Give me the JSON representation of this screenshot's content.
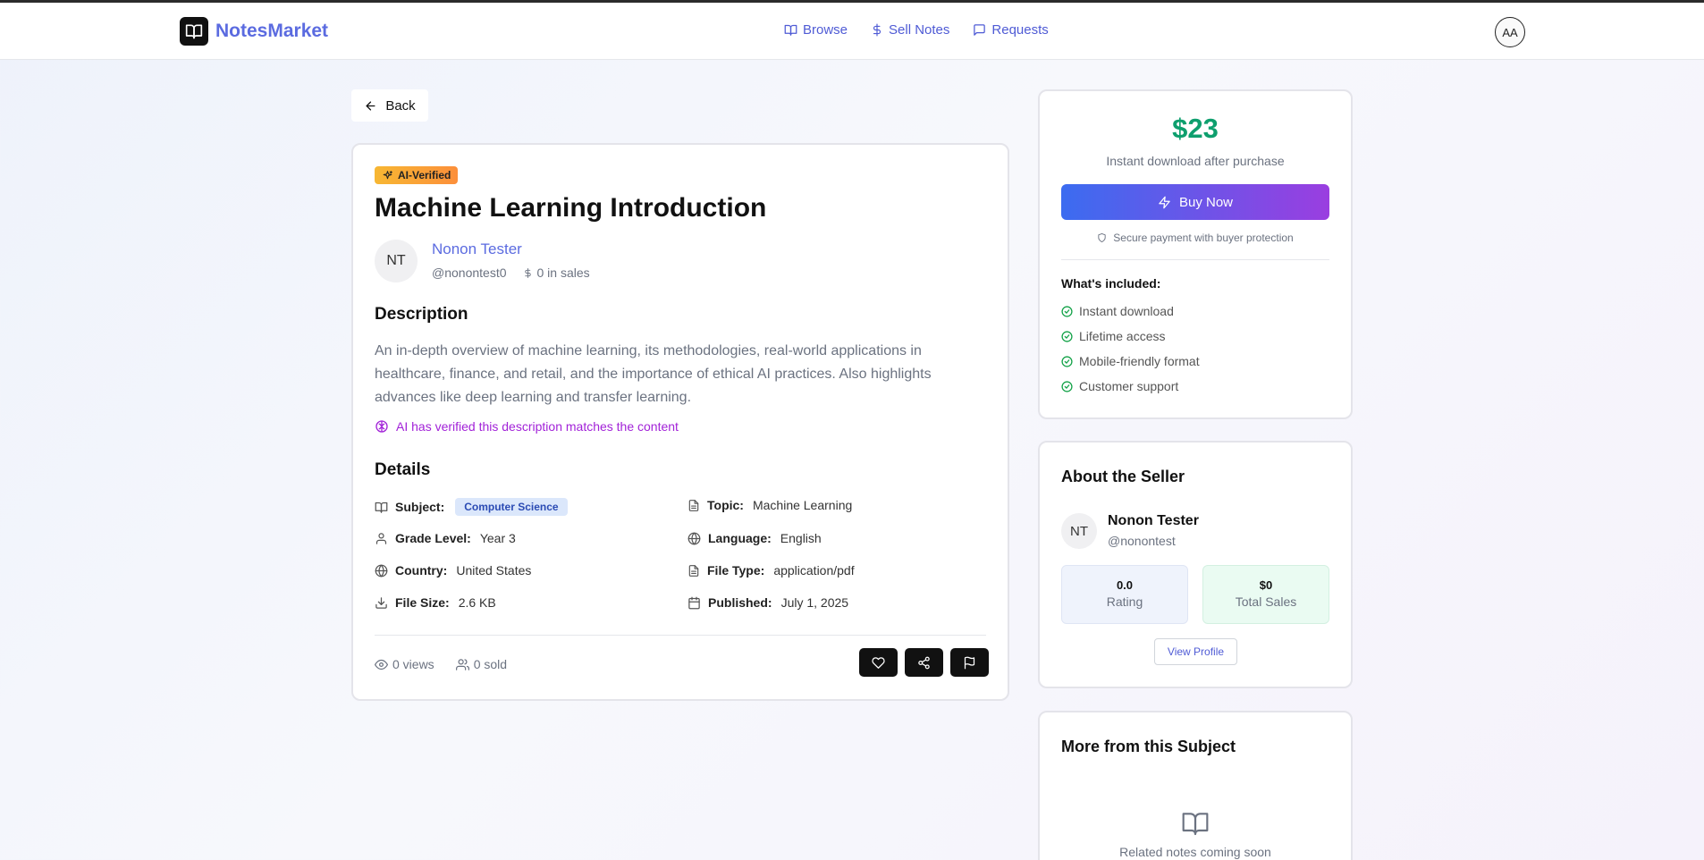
{
  "header": {
    "brand": "NotesMarket",
    "nav": [
      {
        "label": "Browse",
        "icon": "book-open-icon"
      },
      {
        "label": "Sell Notes",
        "icon": "dollar-icon"
      },
      {
        "label": "Requests",
        "icon": "message-icon"
      }
    ],
    "user_initials": "AA"
  },
  "back_label": "Back",
  "note": {
    "badge": "AI-Verified",
    "title": "Machine Learning Introduction",
    "author": {
      "initials": "NT",
      "name": "Nonon Tester",
      "handle": "@nonontest0",
      "sales": "0 in sales"
    },
    "description_heading": "Description",
    "description": "An in-depth overview of machine learning, its methodologies, real-world applications in healthcare, finance, and retail, and the importance of ethical AI practices. Also highlights advances like deep learning and transfer learning.",
    "ai_note": "AI has verified this description matches the content",
    "details_heading": "Details",
    "details": {
      "subject": {
        "label": "Subject:",
        "value": "Computer Science"
      },
      "topic": {
        "label": "Topic:",
        "value": "Machine Learning"
      },
      "grade": {
        "label": "Grade Level:",
        "value": "Year 3"
      },
      "language": {
        "label": "Language:",
        "value": "English"
      },
      "country": {
        "label": "Country:",
        "value": "United States"
      },
      "file_type": {
        "label": "File Type:",
        "value": "application/pdf"
      },
      "file_size": {
        "label": "File Size:",
        "value": "2.6 KB"
      },
      "published": {
        "label": "Published:",
        "value": "July 1, 2025"
      }
    },
    "views": "0 views",
    "sold": "0 sold"
  },
  "purchase": {
    "price": "$23",
    "subtitle": "Instant download after purchase",
    "buy_label": "Buy Now",
    "secure": "Secure payment with buyer protection",
    "included_title": "What's included:",
    "included": [
      "Instant download",
      "Lifetime access",
      "Mobile-friendly format",
      "Customer support"
    ]
  },
  "seller": {
    "heading": "About the Seller",
    "initials": "NT",
    "name": "Nonon Tester",
    "handle": "@nonontest",
    "rating_value": "0.0",
    "rating_label": "Rating",
    "sales_value": "$0",
    "sales_label": "Total Sales",
    "view_profile": "View Profile"
  },
  "more": {
    "heading": "More from this Subject",
    "placeholder": "Related notes coming soon"
  },
  "colors": {
    "accent": "#5b6be0",
    "price": "#0e9f6e",
    "ai": "#a222d8"
  }
}
